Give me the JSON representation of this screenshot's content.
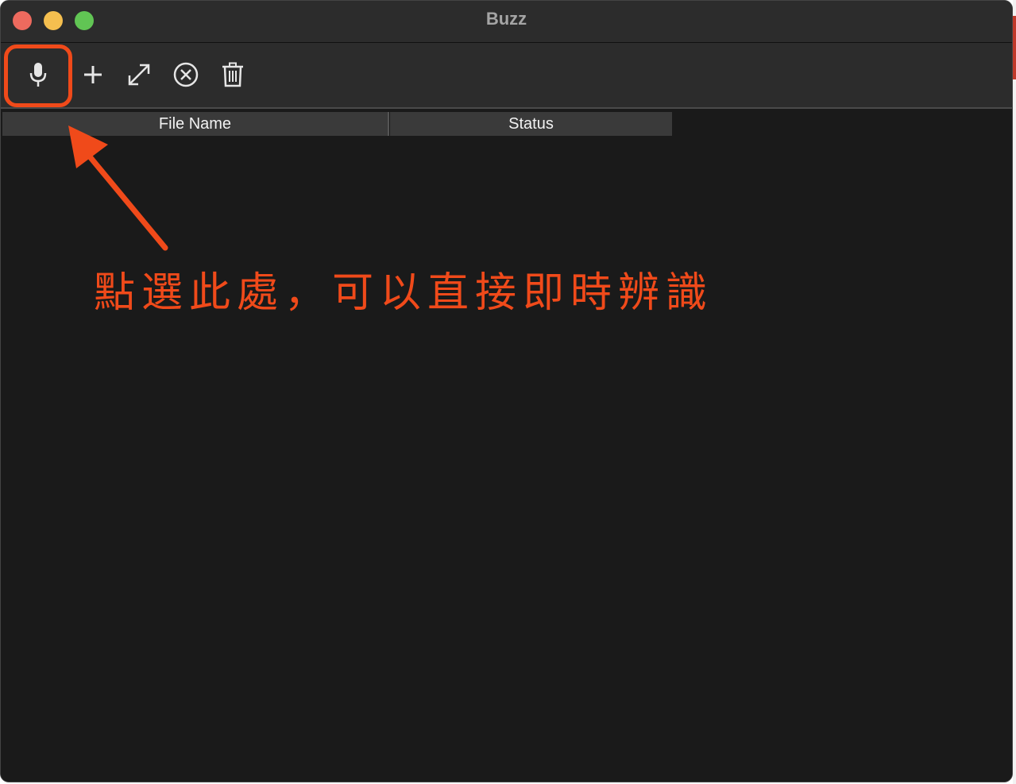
{
  "window": {
    "title": "Buzz"
  },
  "toolbar": {
    "buttons": [
      {
        "name": "microphone-icon",
        "label": "Record"
      },
      {
        "name": "plus-icon",
        "label": "Add"
      },
      {
        "name": "expand-icon",
        "label": "Open"
      },
      {
        "name": "cancel-circle-icon",
        "label": "Stop"
      },
      {
        "name": "trash-icon",
        "label": "Delete"
      }
    ]
  },
  "table": {
    "columns": [
      "File Name",
      "Status"
    ],
    "rows": []
  },
  "annotation": {
    "text": "點選此處，可以直接即時辨識",
    "color": "#f04a1a"
  },
  "colors": {
    "close": "#ed6a5e",
    "minimize": "#f5bf4f",
    "zoom": "#61c554",
    "accent": "#f04a1a"
  }
}
